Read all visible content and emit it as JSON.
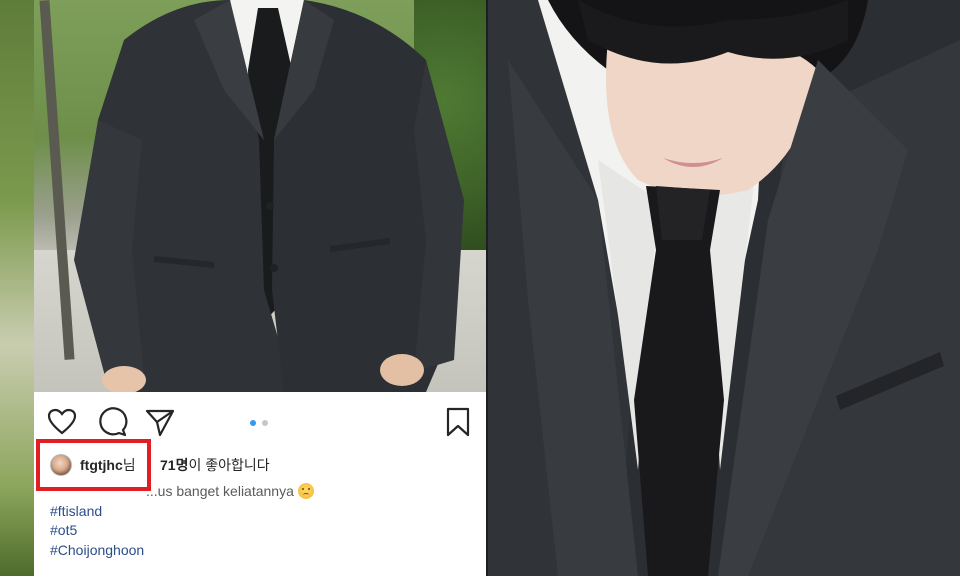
{
  "post": {
    "username": "ftgtjhc",
    "username_suffix": "님",
    "likes_count": "71명",
    "likes_text": "이 좋아합니다",
    "caption_text": "...us banget keliatannya",
    "hashtags": [
      "#ftisland",
      "#ot5",
      "#Choijonghoon"
    ],
    "carousel": {
      "count": 2,
      "active_index": 0
    },
    "icons": {
      "like": "heart-icon",
      "comment": "comment-bubble-icon",
      "share": "paper-plane-icon",
      "save": "bookmark-icon",
      "caption_emoji": "sad-face-emoji"
    }
  },
  "colors": {
    "highlight_box": "#e01e24",
    "carousel_active": "#3897f0",
    "hashtag": "#2b4d8a"
  }
}
